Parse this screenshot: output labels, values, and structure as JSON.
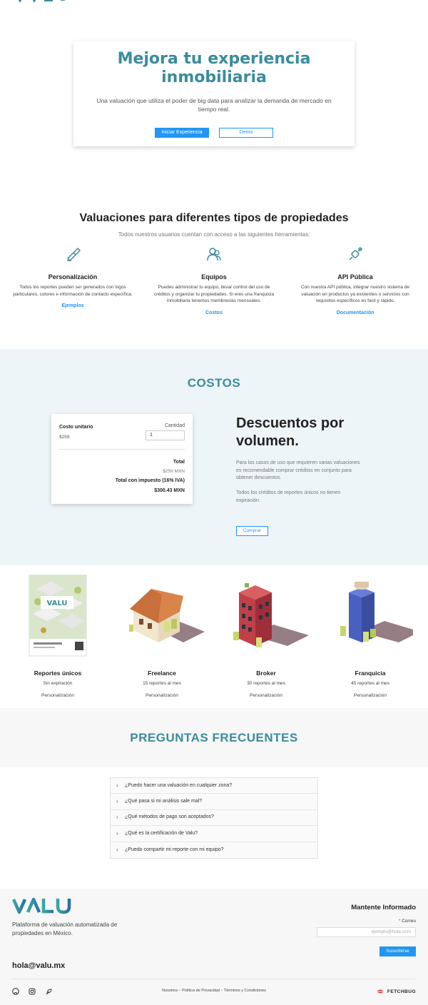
{
  "hero": {
    "title": "Mejora tu experiencia inmobiliaria",
    "subtitle": "Una valuación que utiliza el poder de big data para analizar la demanda de mercado en tiempo real.",
    "primary_btn": "Iniciar Experiencia",
    "secondary_btn": "Demo"
  },
  "features": {
    "title": "Valuaciones para diferentes tipos de propiedades",
    "subtitle": "Todos nuestros usuarios cuentan con acceso a las siguientes herramientas:",
    "items": [
      {
        "icon": "paint-brush-icon",
        "name": "Personalización",
        "desc": "Todos los reportes pueden ser generados con logos particulares, colores e información de contacto específica.",
        "link": "Ejemplos"
      },
      {
        "icon": "team-icon",
        "name": "Equipos",
        "desc": "Puedes administrar tu equipo, llevar control del uso de créditos y organizar tu propiedades. Si eres una franquicia inmobiliaria tenemos membresías mensuales.",
        "link": "Costos"
      },
      {
        "icon": "plug-icon",
        "name": "API Pública",
        "desc": "Con nuestra API pública, integrar nuestro sistema de valuación en productos ya existentes o servicios con requisitos específicos es fácil y rápido.",
        "link": "Documentación"
      }
    ]
  },
  "costos": {
    "title": "COSTOS",
    "unit_label": "Costo unitario",
    "unit_price": "$259",
    "qty_label": "Cantidad",
    "qty_value": "1",
    "total_label": "Total",
    "total_value": "$259 MXN",
    "tax_label": "Total con impuesto (16% IVA)",
    "tax_value": "$300.43 MXN",
    "discount_title": "Descuentos por volumen.",
    "discount_p1": "Para los casos de uso que requieren varias valuaciones es recomendable comprar créditos en conjunto para obtener descuentos.",
    "discount_p2": "Todos los créditos de reportes únicos no tienen expiración.",
    "buy_btn": "Comprar"
  },
  "plans": [
    {
      "name": "Reportes únicos",
      "detail": "Sin expiración",
      "feature": "Personalización"
    },
    {
      "name": "Freelance",
      "detail": "15 reportes al mes",
      "feature": "Personalización"
    },
    {
      "name": "Broker",
      "detail": "30 reportes al mes",
      "feature": "Personalización"
    },
    {
      "name": "Franquicia",
      "detail": "45 reportes al mes",
      "feature": "Personalización"
    }
  ],
  "faq": {
    "title": "PREGUNTAS FRECUENTES",
    "items": [
      "¿Puedo hacer una valuación en cualquier zona?",
      "¿Qué pasa si mi análisis sale mal?",
      "¿Qué métodos de pago son aceptados?",
      "¿Qué es la certificación de Valu?",
      "¿Puedo compartir mi reporte con mi equipo?"
    ]
  },
  "footer": {
    "logo_text": "VALU",
    "description": "Plataforma de valuación automatizada de propiedades en México.",
    "email": "hola@valu.mx",
    "newsletter_title": "Mantente Informado",
    "newsletter_label": "Correo",
    "newsletter_placeholder": "ejemplo@hola.com",
    "newsletter_btn": "Suscribirse",
    "links": [
      "Nosotros",
      "Política de Privacidad",
      "Términos y Condiciones"
    ],
    "brand": "FETCHBUG"
  },
  "colors": {
    "brand_teal": "#3a8c9e",
    "accent_blue": "#2196f3",
    "costos_bg": "#eef5f8"
  }
}
